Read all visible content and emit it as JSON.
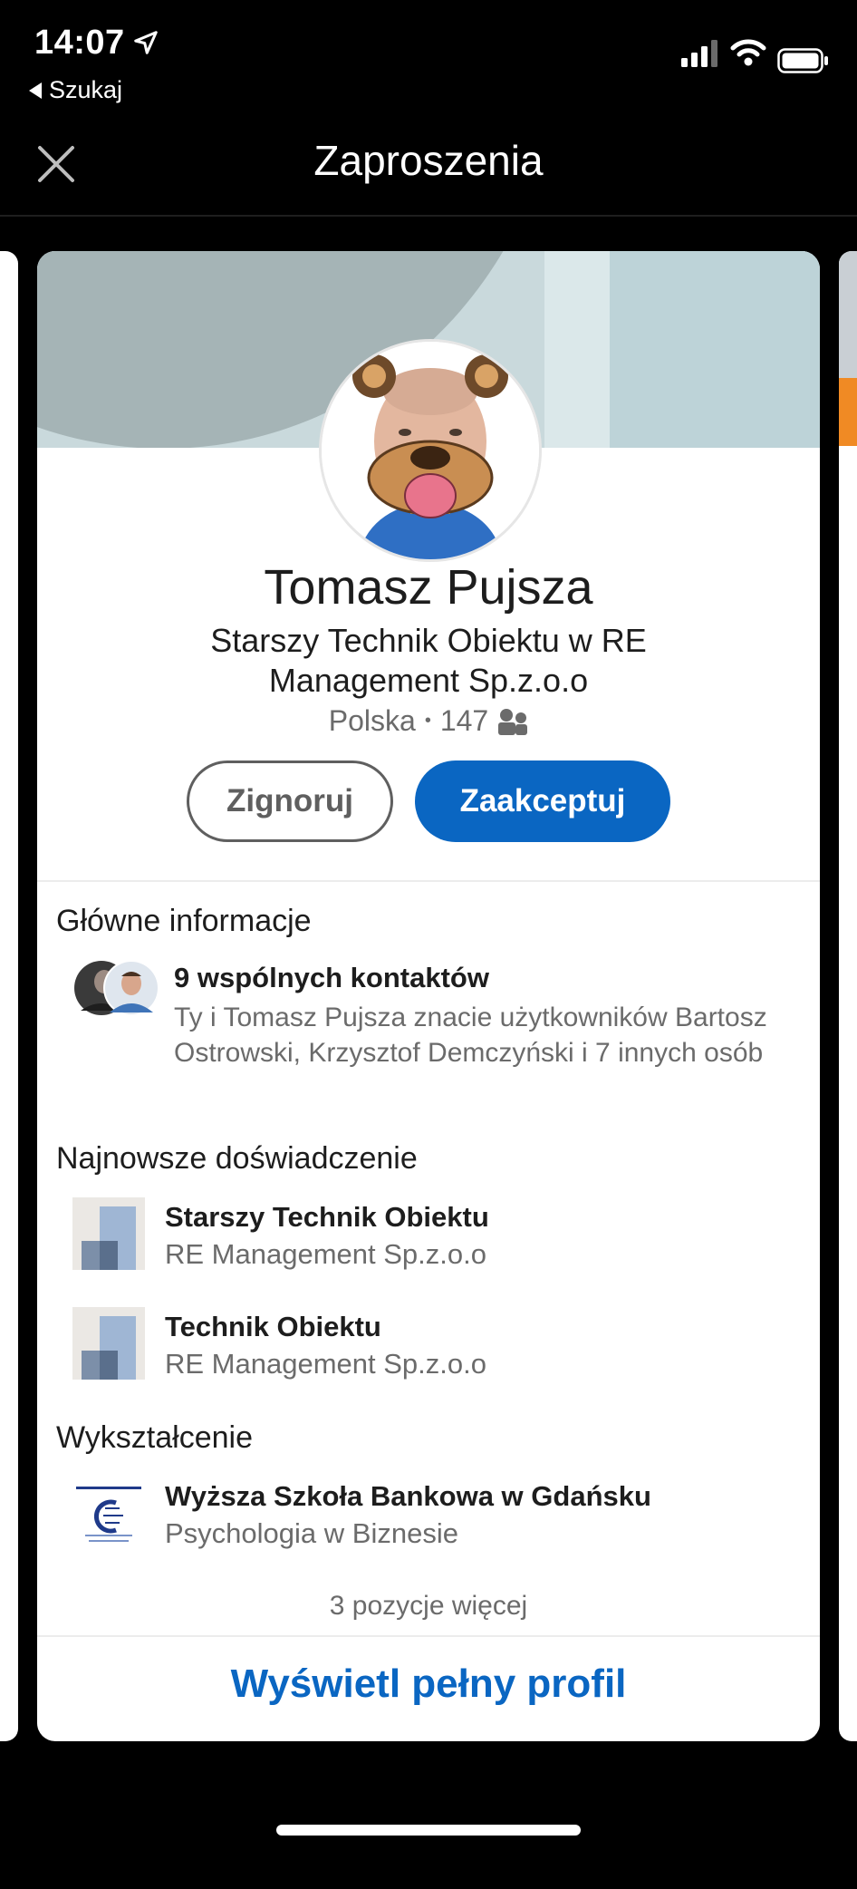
{
  "status_bar": {
    "time": "14:07",
    "back_label": "Szukaj",
    "icons": [
      "location-arrow-icon",
      "signal-icon",
      "wifi-icon",
      "battery-icon"
    ]
  },
  "header": {
    "title": "Zaproszenia",
    "close_icon": "close-icon"
  },
  "profile": {
    "name": "Tomasz Pujsza",
    "headline": "Starszy Technik Obiektu w RE Management Sp.z.o.o",
    "location": "Polska",
    "connections": "147",
    "connections_icon": "people-icon"
  },
  "actions": {
    "ignore_label": "Zignoruj",
    "accept_label": "Zaakceptuj"
  },
  "highlights": {
    "title": "Główne informacje",
    "mutual_title": "9 wspólnych kontaktów",
    "mutual_desc": "Ty i Tomasz Pujsza znacie użytkowników Bartosz Ostrowski, Krzysztof Demczyński i 7 innych osób"
  },
  "experience": {
    "title": "Najnowsze doświadczenie",
    "items": [
      {
        "title": "Starszy Technik Obiektu",
        "company": "RE Management Sp.z.o.o"
      },
      {
        "title": "Technik Obiektu",
        "company": "RE Management Sp.z.o.o"
      }
    ]
  },
  "education": {
    "title": "Wykształcenie",
    "school": "Wyższa Szkoła Bankowa w Gdańsku",
    "field": "Psychologia w Biznesie"
  },
  "more_label": "3 pozycje więcej",
  "full_profile_label": "Wyświetl pełny profil",
  "colors": {
    "accent": "#0a66c2",
    "secondary_text": "#6b6b6b",
    "background": "#000000"
  }
}
